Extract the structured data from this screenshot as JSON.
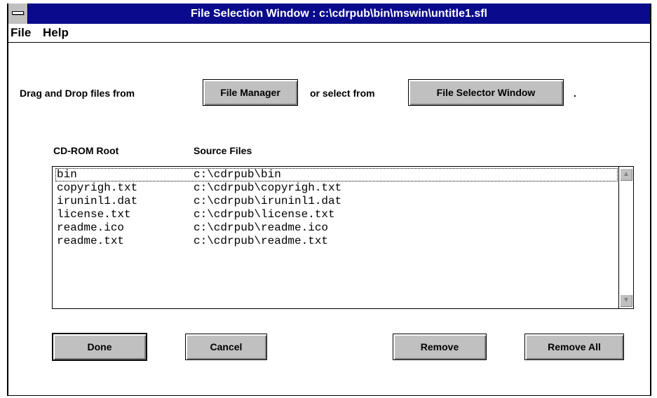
{
  "window": {
    "title": "File Selection Window : c:\\cdrpub\\bin\\mswin\\untitle1.sfl"
  },
  "menu": {
    "file": "File",
    "help": "Help"
  },
  "instructions": {
    "prefix": "Drag and Drop files from",
    "middle": "or select from",
    "suffix": ".",
    "file_manager_button": "File Manager",
    "file_selector_button": "File Selector Window"
  },
  "list": {
    "columns": [
      "CD-ROM Root",
      "Source Files"
    ],
    "rows": [
      {
        "root": "bin",
        "source": "c:\\cdrpub\\bin"
      },
      {
        "root": "copyrigh.txt",
        "source": "c:\\cdrpub\\copyrigh.txt"
      },
      {
        "root": "iruninl1.dat",
        "source": "c:\\cdrpub\\iruninl1.dat"
      },
      {
        "root": "license.txt",
        "source": "c:\\cdrpub\\license.txt"
      },
      {
        "root": "readme.ico",
        "source": "c:\\cdrpub\\readme.ico"
      },
      {
        "root": "readme.txt",
        "source": "c:\\cdrpub\\readme.txt"
      }
    ]
  },
  "buttons": {
    "done": "Done",
    "cancel": "Cancel",
    "remove": "Remove",
    "remove_all": "Remove All"
  },
  "icons": {
    "system_menu": "system-menu-icon",
    "scroll_up": "scroll-up-arrow-icon",
    "scroll_down": "scroll-down-arrow-icon"
  },
  "colors": {
    "title_bar": "#0a0a8c",
    "button_face": "#c0c0c0"
  }
}
